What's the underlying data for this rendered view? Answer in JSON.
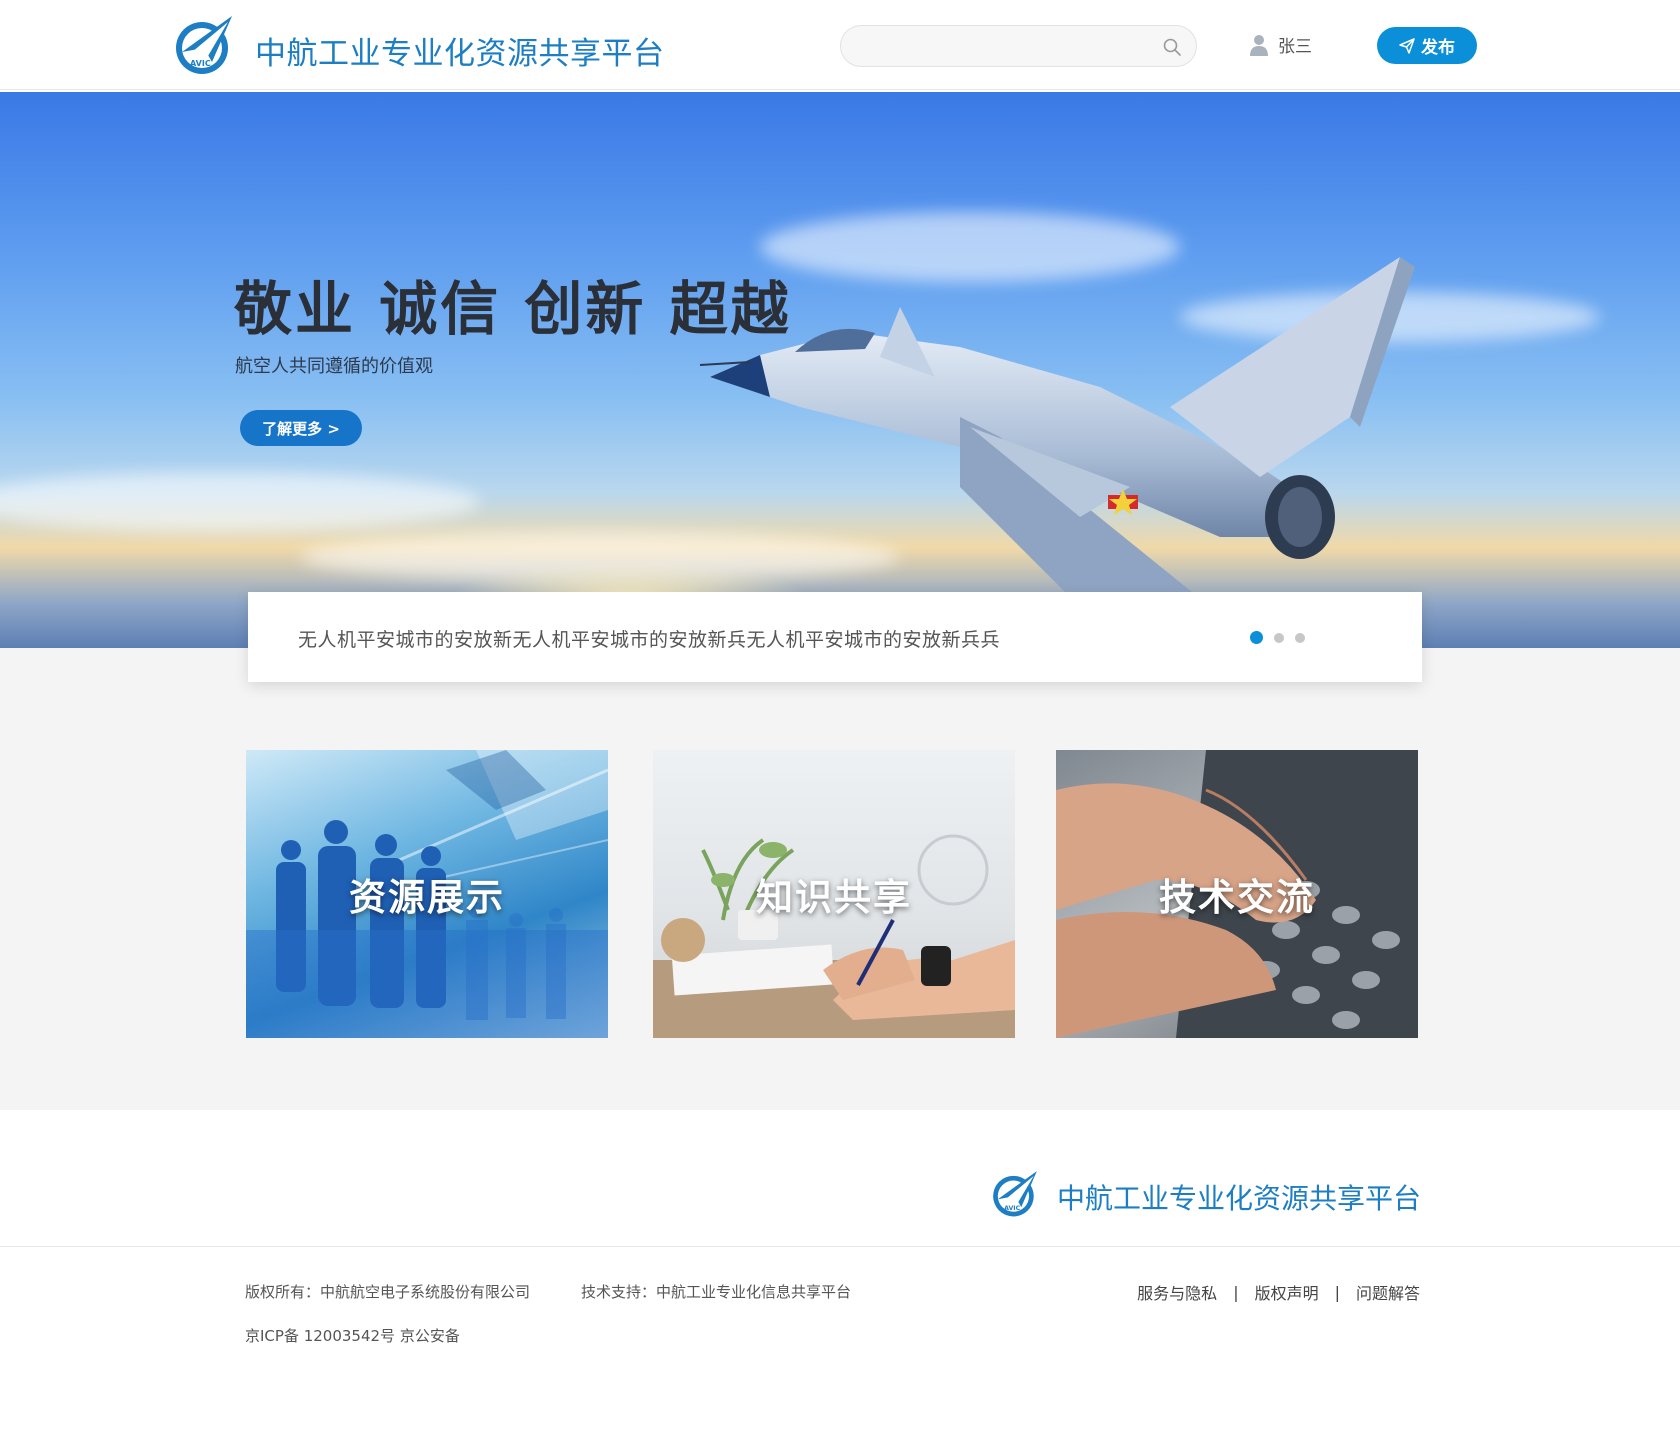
{
  "header": {
    "brand": "中航工业专业化资源共享平台",
    "search_placeholder": "",
    "user_name": "张三",
    "publish_label": "发布"
  },
  "banner": {
    "slogan": "敬业 诚信 创新 超越",
    "subtitle": "航空人共同遵循的价值观",
    "more_label": "了解更多 >"
  },
  "notice": {
    "text": "无人机平安城市的安放新无人机平安城市的安放新兵无人机平安城市的安放新兵兵",
    "dots": 3,
    "active_dot": 1
  },
  "cards": [
    {
      "title": "资源展示"
    },
    {
      "title": "知识共享"
    },
    {
      "title": "技术交流"
    }
  ],
  "footer": {
    "brand": "中航工业专业化资源共享平台",
    "copyright": "版权所有：中航航空电子系统股份有限公司",
    "tech_support": "技术支持：中航工业专业化信息共享平台",
    "icp": "京ICP备 12003542号 京公安备",
    "links": [
      "服务与隐私",
      "版权声明",
      "问题解答"
    ]
  },
  "colors": {
    "brand_blue": "#1d7ec3",
    "button_blue": "#0a8fd8",
    "page_gray": "#f4f4f4"
  },
  "icons": {
    "logo": "avic-logo-icon",
    "search": "search-icon",
    "user": "user-icon",
    "publish": "paper-plane-icon"
  }
}
